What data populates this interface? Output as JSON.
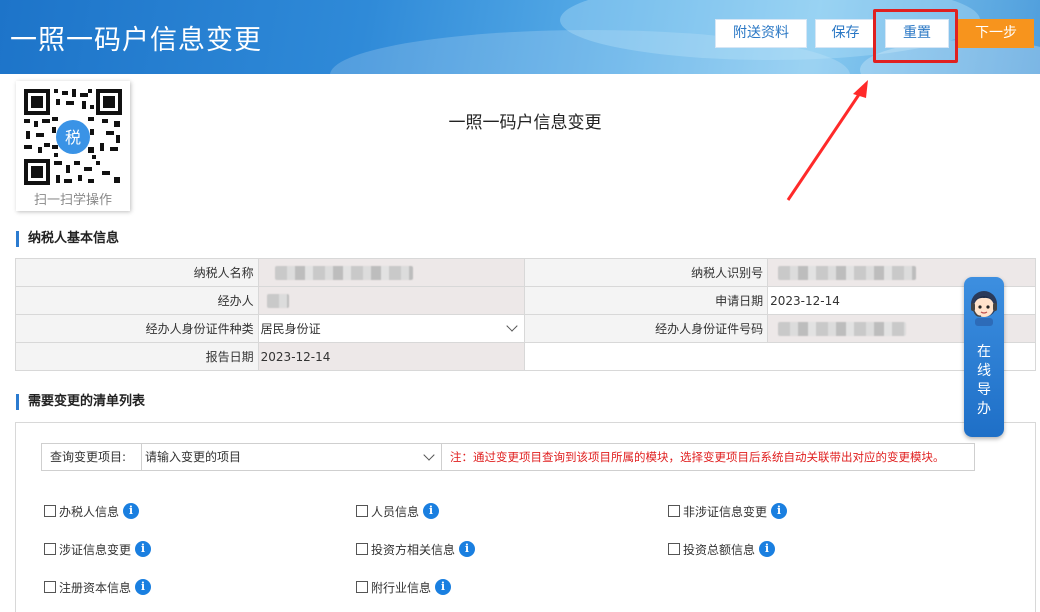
{
  "header": {
    "title": "一照一码户信息变更",
    "buttons": {
      "attach": "附送资料",
      "save": "保存",
      "reset": "重置",
      "next": "下一步"
    }
  },
  "qr": {
    "caption": "扫一扫学操作",
    "badge": "税"
  },
  "page_title": "一照一码户信息变更",
  "basic_info": {
    "section_title": "纳税人基本信息",
    "taxpayer_name_label": "纳税人名称",
    "taxpayer_id_label": "纳税人识别号",
    "agent_label": "经办人",
    "apply_date_label": "申请日期",
    "apply_date": "2023-12-14",
    "agent_id_type_label": "经办人身份证件种类",
    "agent_id_type": "居民身份证",
    "agent_id_no_label": "经办人身份证件号码",
    "report_date_label": "报告日期",
    "report_date": "2023-12-14"
  },
  "change_list": {
    "section_title": "需要变更的清单列表",
    "query_label": "查询变更项目:",
    "query_placeholder": "请输入变更的项目",
    "note": "注：通过变更项目查询到该项目所属的模块，选择变更项目后系统自动关联带出对应的变更模块。",
    "options": [
      "办税人信息",
      "人员信息",
      "非涉证信息变更",
      "涉证信息变更",
      "投资方相关信息",
      "投资总额信息",
      "注册资本信息",
      "附行业信息"
    ],
    "info_icon": "i"
  },
  "guide": {
    "text": "在线导办"
  },
  "colors": {
    "accent": "#2b7bd0",
    "next_button": "#f7941d",
    "highlight": "#e02020",
    "note": "#e02020",
    "info_icon": "#1a7fe0"
  }
}
